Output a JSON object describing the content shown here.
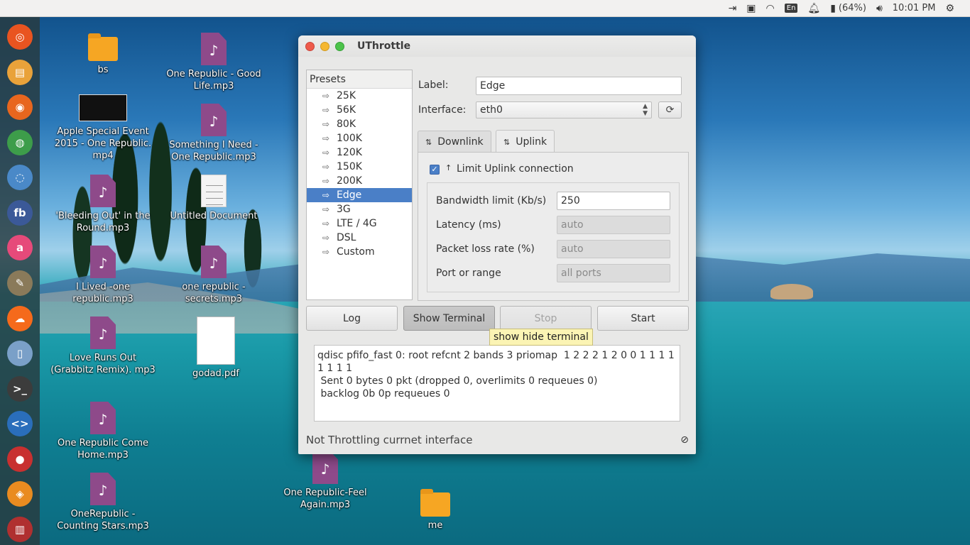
{
  "top_panel": {
    "language": "En",
    "battery": "(64%)",
    "time": "10:01 PM"
  },
  "launcher": {
    "items": [
      {
        "name": "ubuntu-dash",
        "color": "#e95420"
      },
      {
        "name": "files",
        "color": "#e9a23a"
      },
      {
        "name": "firefox",
        "color": "#e8661e"
      },
      {
        "name": "chrome",
        "color": "#3d9d4a"
      },
      {
        "name": "chromium",
        "color": "#4a89c8"
      },
      {
        "name": "fb",
        "color": "#3b5998"
      },
      {
        "name": "app-a",
        "color": "#e64a7a"
      },
      {
        "name": "gimp",
        "color": "#8a7a5a"
      },
      {
        "name": "soundcloud",
        "color": "#f56a1b"
      },
      {
        "name": "phone",
        "color": "#7aa0c8"
      },
      {
        "name": "terminal",
        "color": "#3c3c3c"
      },
      {
        "name": "code-editor",
        "color": "#2a6ebb"
      },
      {
        "name": "cherries",
        "color": "#c83030"
      },
      {
        "name": "software-center",
        "color": "#e98b20"
      },
      {
        "name": "trash",
        "color": "#b03030"
      }
    ],
    "fb_label": "fb"
  },
  "desktop": {
    "icons": [
      {
        "label": "bs"
      },
      {
        "label": "One Republic - Good Life.mp3"
      },
      {
        "label": "Apple Special Event 2015 - One Republic. mp4"
      },
      {
        "label": "Something I Need - One Republic.mp3"
      },
      {
        "label": "'Bleeding Out' in the Round.mp3"
      },
      {
        "label": "Untitled Document"
      },
      {
        "label": "I Lived -one republic.mp3"
      },
      {
        "label": "one republic - secrets.mp3"
      },
      {
        "label": "Love Runs Out (Grabbitz Remix). mp3"
      },
      {
        "label": "godad.pdf"
      },
      {
        "label": "One Republic Come Home.mp3"
      },
      {
        "label": "OneRepublic - Counting Stars.mp3"
      },
      {
        "label": "One Republic-Feel Again.mp3"
      },
      {
        "label": "me"
      }
    ],
    "music_glyph": "♪"
  },
  "window": {
    "title": "UThrottle",
    "presets": {
      "header": "Presets",
      "items": [
        "25K",
        "56K",
        "80K",
        "100K",
        "120K",
        "150K",
        "200K",
        "Edge",
        "3G",
        "LTE / 4G",
        "DSL",
        "Custom"
      ],
      "selected": "Edge"
    },
    "label_field": {
      "label": "Label:",
      "value": "Edge"
    },
    "interface_field": {
      "label": "Interface:",
      "value": "eth0"
    },
    "tabs": [
      {
        "label": "Downlink",
        "active": false
      },
      {
        "label": "Uplink",
        "active": true
      }
    ],
    "limit_checkbox": {
      "label": "Limit Uplink connection",
      "checked": true
    },
    "fields": [
      {
        "label": "Bandwidth limit (Kb/s)",
        "value": "250",
        "disabled": false
      },
      {
        "label": "Latency (ms)",
        "value": "auto",
        "disabled": true
      },
      {
        "label": "Packet loss rate (%)",
        "value": "auto",
        "disabled": true
      },
      {
        "label": "Port or range",
        "value": "all ports",
        "disabled": true
      }
    ],
    "buttons": {
      "log": "Log",
      "show_terminal": "Show Terminal",
      "stop": "Stop",
      "start": "Start"
    },
    "tooltip": "show hide terminal",
    "terminal_output": "qdisc pfifo_fast 0: root refcnt 2 bands 3 priomap  1 2 2 2 1 2 0 0 1 1 1 1 1 1 1 1\n Sent 0 bytes 0 pkt (dropped 0, overlimits 0 requeues 0)\n backlog 0b 0p requeues 0",
    "status": "Not Throttling currnet interface"
  }
}
